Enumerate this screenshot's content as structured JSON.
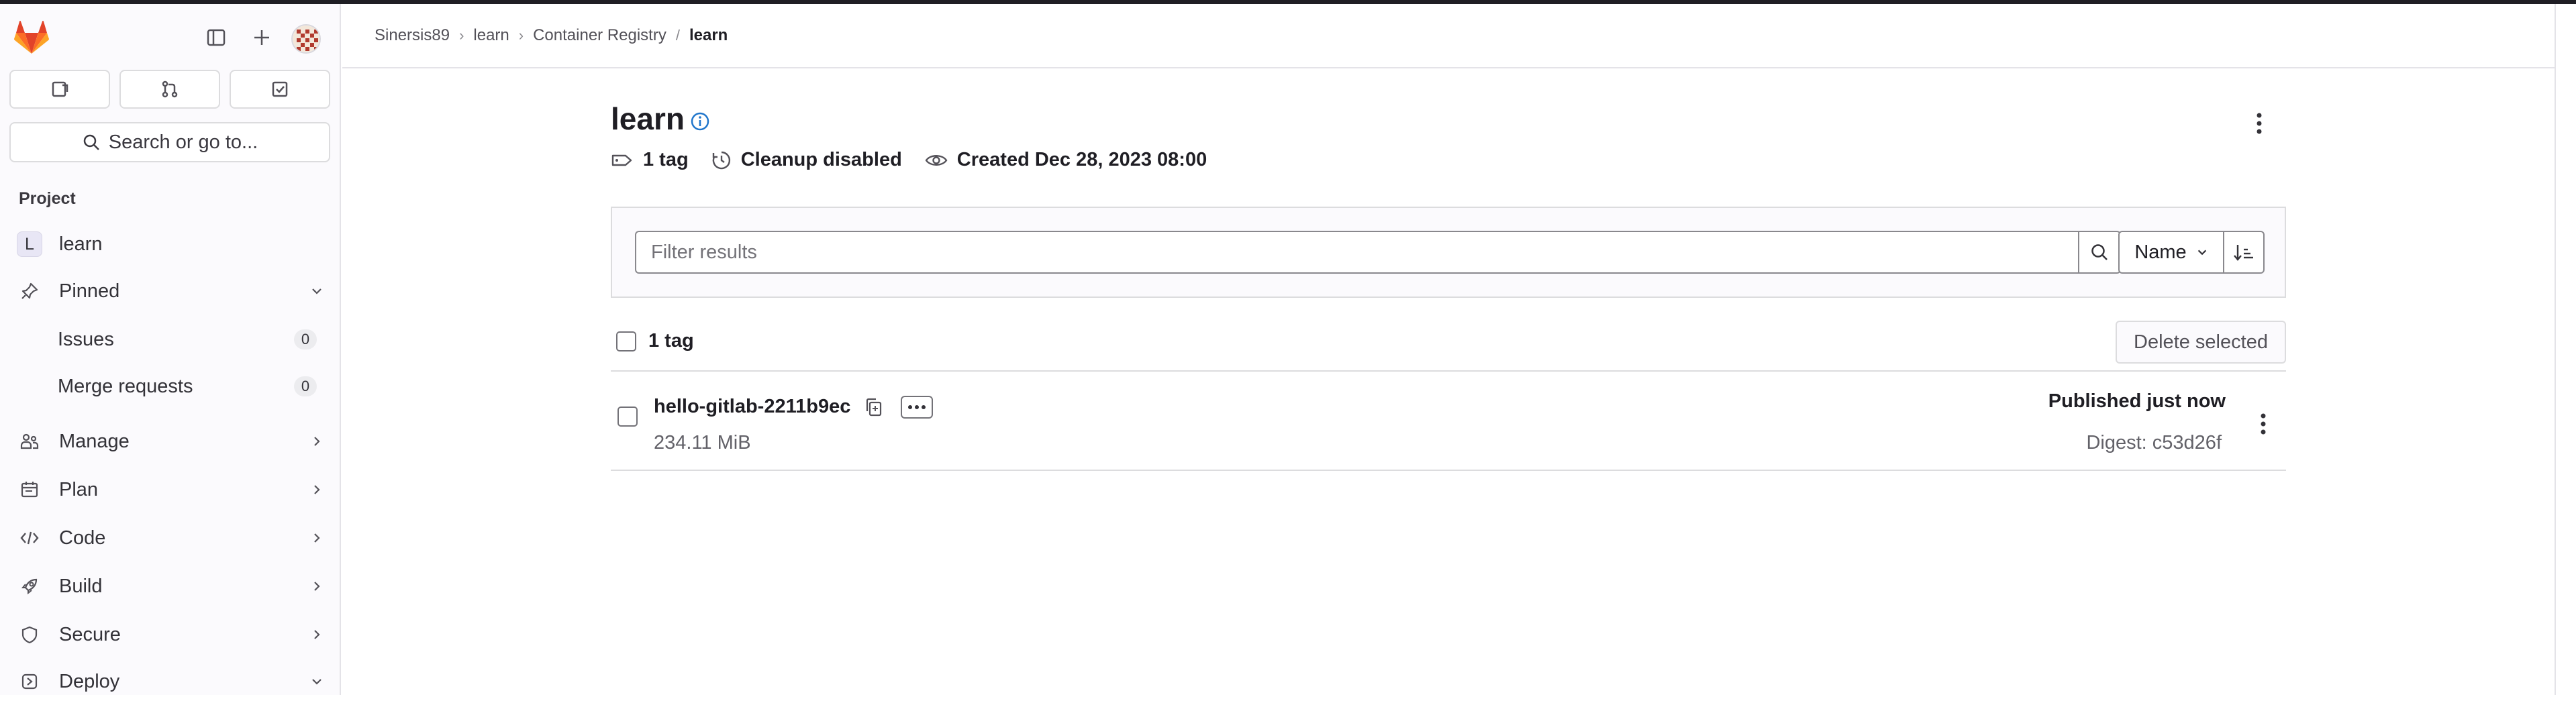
{
  "sidebar": {
    "quick_actions": [
      "issues-icon",
      "merge-request-icon",
      "todo-icon"
    ],
    "search_label": "Search or go to...",
    "section_title": "Project",
    "project": {
      "initial": "L",
      "name": "learn"
    },
    "pinned_label": "Pinned",
    "pinned_items": [
      {
        "label": "Issues",
        "count": "0"
      },
      {
        "label": "Merge requests",
        "count": "0"
      }
    ],
    "nav": [
      {
        "label": "Manage",
        "icon": "users-icon"
      },
      {
        "label": "Plan",
        "icon": "planning-icon"
      },
      {
        "label": "Code",
        "icon": "code-icon"
      },
      {
        "label": "Build",
        "icon": "rocket-icon"
      },
      {
        "label": "Secure",
        "icon": "shield-icon"
      },
      {
        "label": "Deploy",
        "icon": "deploy-icon"
      }
    ]
  },
  "breadcrumbs": [
    "Sinersis89",
    "learn",
    "Container Registry",
    "learn"
  ],
  "page": {
    "title": "learn",
    "meta": {
      "tags": "1 tag",
      "cleanup": "Cleanup disabled",
      "created": "Created Dec 28, 2023 08:00"
    }
  },
  "filter": {
    "placeholder": "Filter results",
    "sort_label": "Name"
  },
  "list": {
    "header_label": "1 tag",
    "delete_label": "Delete selected",
    "rows": [
      {
        "name": "hello-gitlab-2211b9ec",
        "size": "234.11 MiB",
        "published": "Published just now",
        "digest": "Digest: c53d26f"
      }
    ]
  },
  "colors": {
    "accent": "#1f75cb",
    "text": "#1f1e24",
    "muted": "#626168",
    "border": "#dcdcde",
    "sidebar_bg": "#fbfafd"
  }
}
